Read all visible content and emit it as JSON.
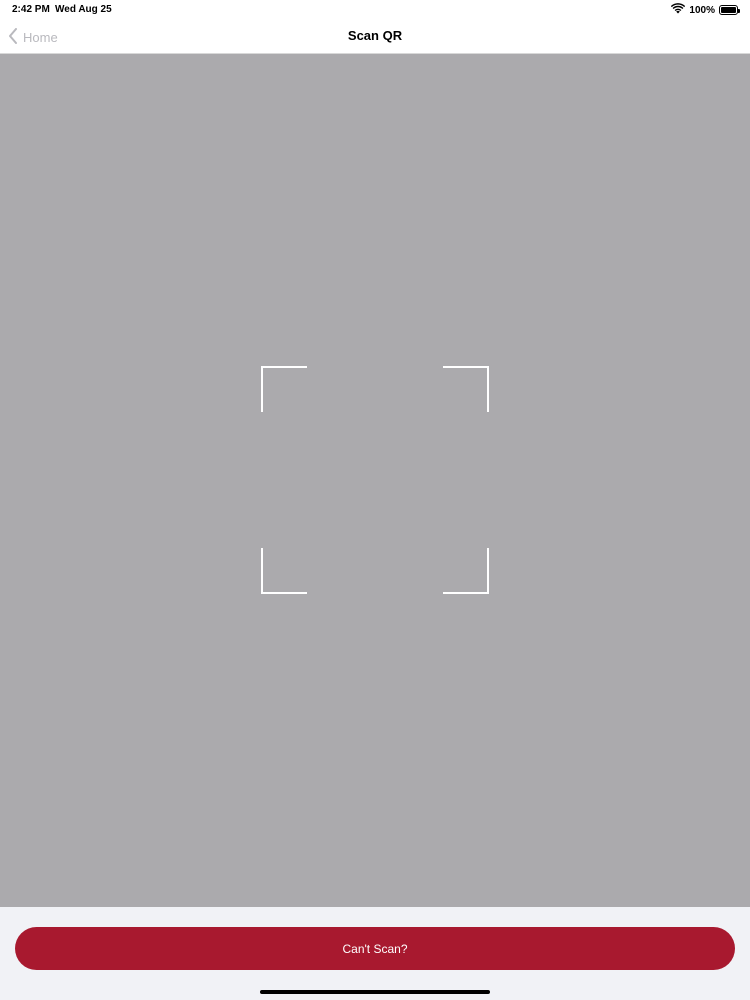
{
  "status_bar": {
    "time": "2:42 PM",
    "date": "Wed Aug 25",
    "battery_percent": "100%",
    "battery_level": 1.0,
    "icons": [
      "wifi-icon",
      "battery-icon"
    ]
  },
  "nav": {
    "back_label": "Home",
    "title": "Scan QR",
    "back_icon": "chevron-left-icon"
  },
  "camera": {
    "background_color": "#abaaad",
    "frame_color": "#ffffff"
  },
  "actions": {
    "cant_scan_label": "Can't Scan?",
    "button_color": "#a8192f"
  }
}
